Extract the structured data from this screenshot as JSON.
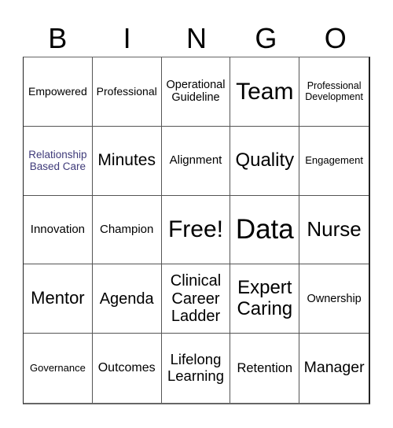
{
  "header": {
    "letters": [
      "B",
      "I",
      "N",
      "G",
      "O"
    ]
  },
  "board": {
    "cells": [
      {
        "text": "Empowered",
        "size": 14,
        "color": "#000000"
      },
      {
        "text": "Professional",
        "size": 14,
        "color": "#000000"
      },
      {
        "text": "Operational Guideline",
        "size": 14.5,
        "color": "#000000"
      },
      {
        "text": "Team",
        "size": 30,
        "color": "#000000"
      },
      {
        "text": "Professional Development",
        "size": 12.5,
        "color": "#000000"
      },
      {
        "text": "Relationship Based Care",
        "size": 13.5,
        "color": "#3f3b7a"
      },
      {
        "text": "Minutes",
        "size": 21,
        "color": "#000000"
      },
      {
        "text": "Alignment",
        "size": 15,
        "color": "#000000"
      },
      {
        "text": "Quality",
        "size": 24,
        "color": "#000000"
      },
      {
        "text": "Engagement",
        "size": 13,
        "color": "#000000"
      },
      {
        "text": "Innovation",
        "size": 15,
        "color": "#000000"
      },
      {
        "text": "Champion",
        "size": 15,
        "color": "#000000"
      },
      {
        "text": "Free!",
        "size": 30,
        "color": "#000000"
      },
      {
        "text": "Data",
        "size": 35,
        "color": "#000000"
      },
      {
        "text": "Nurse",
        "size": 26,
        "color": "#000000"
      },
      {
        "text": "Mentor",
        "size": 22,
        "color": "#000000"
      },
      {
        "text": "Agenda",
        "size": 20,
        "color": "#000000"
      },
      {
        "text": "Clinical Career Ladder",
        "size": 20,
        "color": "#000000"
      },
      {
        "text": "Expert Caring",
        "size": 24,
        "color": "#000000"
      },
      {
        "text": "Ownership",
        "size": 14.5,
        "color": "#000000"
      },
      {
        "text": "Governance",
        "size": 13,
        "color": "#000000"
      },
      {
        "text": "Outcomes",
        "size": 16,
        "color": "#000000"
      },
      {
        "text": "Lifelong Learning",
        "size": 18.5,
        "color": "#000000"
      },
      {
        "text": "Retention",
        "size": 16.5,
        "color": "#000000"
      },
      {
        "text": "Manager",
        "size": 19.5,
        "color": "#000000"
      }
    ]
  }
}
